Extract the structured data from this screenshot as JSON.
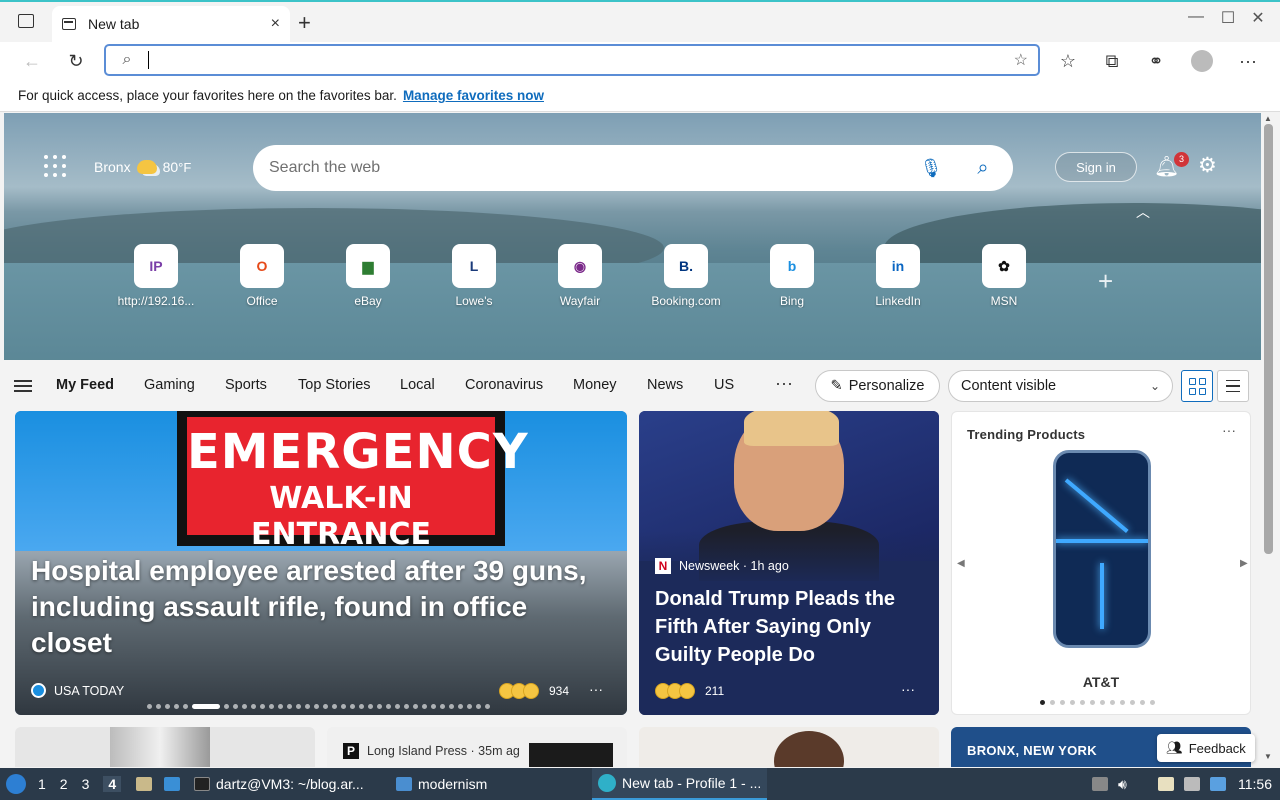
{
  "browser": {
    "tab_title": "New tab",
    "tab_close": "×",
    "new_tab": "+",
    "window_controls": {
      "minimize": "—",
      "maximize": "☐",
      "close": "✕"
    },
    "address_value": "",
    "favbar_text": "For quick access, place your favorites here on the favorites bar.",
    "favbar_link": "Manage favorites now"
  },
  "hero": {
    "location": "Bronx",
    "temperature": "80",
    "unit": "°F",
    "search_placeholder": "Search the web",
    "signin_label": "Sign in",
    "notification_count": "3",
    "quick_links": [
      {
        "label": "http://192.16...",
        "icon": "IP",
        "color": "#7b3fa8"
      },
      {
        "label": "Office",
        "icon": "O",
        "color": "#e64a19"
      },
      {
        "label": "eBay",
        "icon": "▆",
        "color": "#2e7d32"
      },
      {
        "label": "Lowe's",
        "icon": "L",
        "color": "#1a3a7a"
      },
      {
        "label": "Wayfair",
        "icon": "◉",
        "color": "#7b2a8a"
      },
      {
        "label": "Booking.com",
        "icon": "B.",
        "color": "#003580"
      },
      {
        "label": "Bing",
        "icon": "b",
        "color": "#1a8fe0"
      },
      {
        "label": "LinkedIn",
        "icon": "in",
        "color": "#0a66c2"
      },
      {
        "label": "MSN",
        "icon": "✿",
        "color": "#111111"
      }
    ]
  },
  "feednav": {
    "items": [
      "My Feed",
      "Gaming",
      "Sports",
      "Top Stories",
      "Local",
      "Coronavirus",
      "Money",
      "News",
      "US"
    ],
    "more": "···",
    "personalize": "Personalize",
    "content_visible": "Content visible"
  },
  "cards": {
    "card1": {
      "sign_top": "EMERGENCY",
      "sign_bottom": "WALK-IN ENTRANCE",
      "title": "Hospital employee arrested after 39 guns, including assault rifle, found in office closet",
      "source": "USA TODAY",
      "reactions": "934",
      "more": "···"
    },
    "card2": {
      "source": "Newsweek · 1h ago",
      "title": "Donald Trump Pleads the Fifth After Saying Only Guilty People Do",
      "reactions": "211",
      "more": "···"
    },
    "card3": {
      "title": "Trending Products",
      "brand": "AT&T",
      "more": "···",
      "dot_count": 12,
      "active_dot": 0
    },
    "card5_source": "Long Island Press · 35m ag",
    "card7_title": "BRONX, NEW YORK",
    "feedback": "Feedback"
  },
  "taskbar": {
    "workspaces": [
      "1",
      "2",
      "3",
      "4"
    ],
    "terminal": "dartz@VM3: ~/blog.ar...",
    "folder": "modernism",
    "browser": "New tab - Profile 1 - ...",
    "clock": "11:56"
  }
}
